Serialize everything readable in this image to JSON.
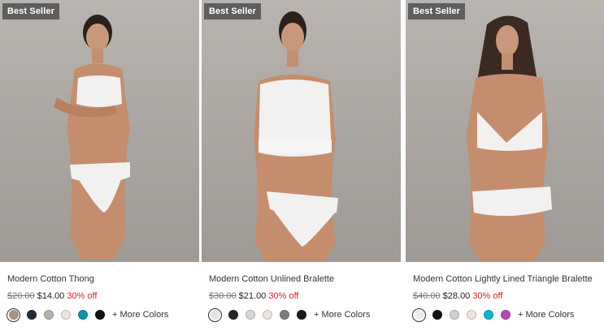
{
  "products": [
    {
      "badge": "Best Seller",
      "name": "Modern Cotton Thong",
      "price_old": "$20.00",
      "price_new": "$14.00",
      "discount": "30% off",
      "swatches": [
        "#a39389",
        "#242a36",
        "#b2b2b2",
        "#ece4e0",
        "#0f92a8",
        "#151515"
      ],
      "selected_swatch": 0,
      "more_colors": "+ More Colors"
    },
    {
      "badge": "Best Seller",
      "name": "Modern Cotton Unlined Bralette",
      "price_old": "$30.00",
      "price_new": "$21.00",
      "discount": "30% off",
      "swatches": [
        "#e6e6e6",
        "#25262b",
        "#d6d6d6",
        "#ede3df",
        "#7a7f80",
        "#1b1b1b"
      ],
      "selected_swatch": 0,
      "more_colors": "+ More Colors"
    },
    {
      "badge": "Best Seller",
      "name": "Modern Cotton Lightly Lined Triangle Bralette",
      "price_old": "$40.00",
      "price_new": "$28.00",
      "discount": "30% off",
      "swatches": [
        "#ececec",
        "#141414",
        "#cfcfcf",
        "#f0e4e0",
        "#12b4c8",
        "#b44cb0"
      ],
      "selected_swatch": 0,
      "more_colors": "+ More Colors"
    }
  ],
  "colors": {
    "badge_bg": "#5e5e5e",
    "discount": "#d0222b",
    "photo_bg": "#aaa5a0"
  }
}
